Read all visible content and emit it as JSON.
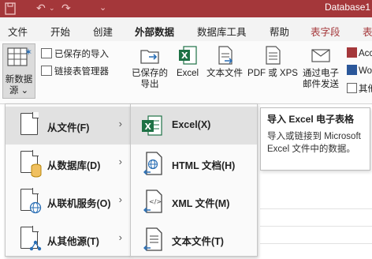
{
  "window": {
    "title": "Database1",
    "accent_color": "#a4373a"
  },
  "quick_access": {
    "save_icon": "save-icon",
    "undo_icon": "undo-icon",
    "redo_icon": "redo-icon",
    "customize_icon": "chevron-down-icon"
  },
  "tabs": [
    {
      "label": "文件"
    },
    {
      "label": "开始"
    },
    {
      "label": "创建"
    },
    {
      "label": "外部数据",
      "active": true
    },
    {
      "label": "数据库工具"
    },
    {
      "label": "帮助"
    },
    {
      "label": "表字段",
      "contextual": true
    },
    {
      "label": "表",
      "contextual": true
    }
  ],
  "ribbon": {
    "new_source_line1": "新数据",
    "new_source_line2": "源 ⌄",
    "saved_imports": "已保存的导入",
    "linked_table_manager": "链接表管理器",
    "saved_exports_line1": "已保存的",
    "saved_exports_line2": "导出",
    "excel": "Excel",
    "text_file": "文本文件",
    "pdf_xps": "PDF 或 XPS",
    "email_line1": "通过电子",
    "email_line2": "邮件发送",
    "access_partial": "Acc",
    "word_partial": "Wo",
    "other_partial": "其他"
  },
  "menu": {
    "items": [
      {
        "label": "从文件(F)",
        "icon": "file-icon"
      },
      {
        "label": "从数据库(D)",
        "icon": "database-file-icon"
      },
      {
        "label": "从联机服务(O)",
        "icon": "online-service-icon"
      },
      {
        "label": "从其他源(T)",
        "icon": "other-source-icon"
      }
    ],
    "arrow": "›"
  },
  "submenu": {
    "items": [
      {
        "label": "Excel(X)",
        "icon": "excel-icon"
      },
      {
        "label": "HTML 文档(H)",
        "icon": "html-document-icon"
      },
      {
        "label": "XML 文件(M)",
        "icon": "xml-file-icon"
      },
      {
        "label": "文本文件(T)",
        "icon": "text-file-icon"
      }
    ]
  },
  "tooltip": {
    "title": "导入 Excel 电子表格",
    "body": "导入或链接到 Microsoft Excel 文件中的数据。"
  }
}
